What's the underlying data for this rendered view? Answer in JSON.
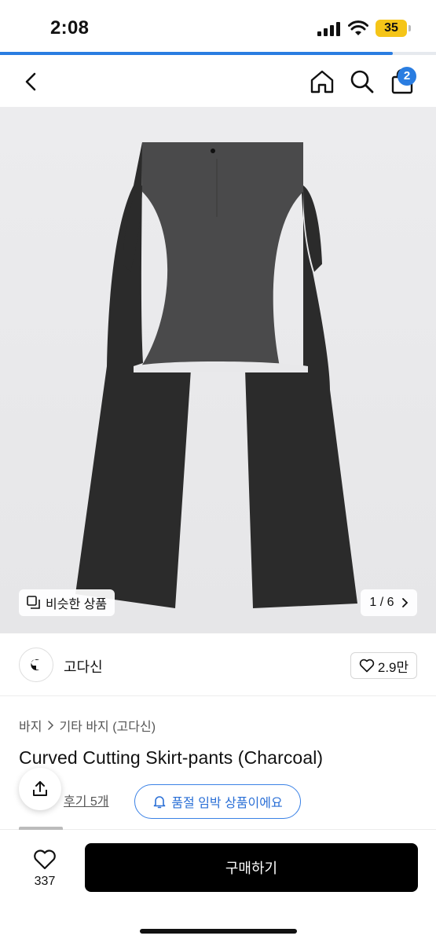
{
  "status_bar": {
    "time": "2:08",
    "battery": "35"
  },
  "page_progress": 0.9,
  "nav": {
    "cart_count": "2",
    "icons": [
      "back-icon",
      "home-icon",
      "search-icon",
      "shopping-bag-icon"
    ]
  },
  "gallery": {
    "similar_label": "비슷한 상품",
    "page_counter": "1 / 6"
  },
  "brand": {
    "name": "고다신",
    "likes": "2.9만"
  },
  "breadcrumb": {
    "category": "바지",
    "subcategory": "기타 바지 (고다신)"
  },
  "product": {
    "title": "Curved Cutting Skirt-pants (Charcoal)",
    "reviews": "후기 5개",
    "soldout_notice": "품절 임박 상품이에요"
  },
  "bottom_bar": {
    "wish_count": "337",
    "buy_label": "구매하기"
  },
  "colors": {
    "accent": "#2a7de1",
    "buy_button": "#000000",
    "garment_dark": "#2b2b2b",
    "garment_panel": "#4a4a4b"
  }
}
